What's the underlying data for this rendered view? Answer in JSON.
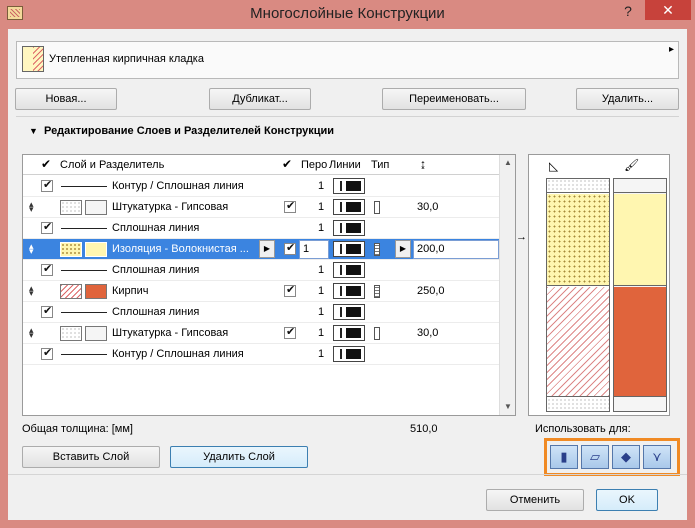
{
  "window": {
    "title": "Многослойные Конструкции",
    "help": "?",
    "close": "✕"
  },
  "header": {
    "name": "Утепленная кирпичная кладка",
    "menu_arrow": "▸"
  },
  "buttons": {
    "new": "Новая...",
    "duplicate": "Дубликат...",
    "rename": "Переименовать...",
    "delete": "Удалить..."
  },
  "section": {
    "title": "Редактирование Слоев и Разделителей Конструкции",
    "arrow": "▼"
  },
  "table": {
    "headers": {
      "check": "✔",
      "layer": "Слой и Разделитель",
      "check2": "✔",
      "pen": "Перо",
      "lines": "Линии",
      "type": "Тип",
      "thickness_icon": "↨"
    },
    "rows": [
      {
        "kind": "line",
        "label": "Контур / Сплошная линия",
        "pen": "1"
      },
      {
        "kind": "layer",
        "label": "Штукатурка - Гипсовая",
        "pen": "1",
        "thickness": "30,0"
      },
      {
        "kind": "line",
        "label": "Сплошная линия",
        "pen": "1"
      },
      {
        "kind": "layer",
        "label": "Изоляция - Волокнистая ...",
        "pen": "1",
        "thickness": "200,0",
        "selected": true
      },
      {
        "kind": "line",
        "label": "Сплошная линия",
        "pen": "1"
      },
      {
        "kind": "layer",
        "label": "Кирпич",
        "pen": "1",
        "thickness": "250,0"
      },
      {
        "kind": "line",
        "label": "Сплошная линия",
        "pen": "1"
      },
      {
        "kind": "layer",
        "label": "Штукатурка - Гипсовая",
        "pen": "1",
        "thickness": "30,0"
      },
      {
        "kind": "line",
        "label": "Контур / Сплошная линия",
        "pen": "1"
      }
    ]
  },
  "total": {
    "label": "Общая толщина: [мм]",
    "value": "510,0"
  },
  "actions": {
    "insert": "Вставить Слой",
    "remove": "Удалить Слой"
  },
  "use_for": {
    "label": "Использовать для:"
  },
  "footer": {
    "cancel": "Отменить",
    "ok": "OK"
  },
  "colors": {
    "titlebar": "#d98a82",
    "selected_row": "#3b84e0",
    "insulation": "#fff6b0",
    "brick": "#e0643c",
    "highlight_box": "#f08a24"
  }
}
